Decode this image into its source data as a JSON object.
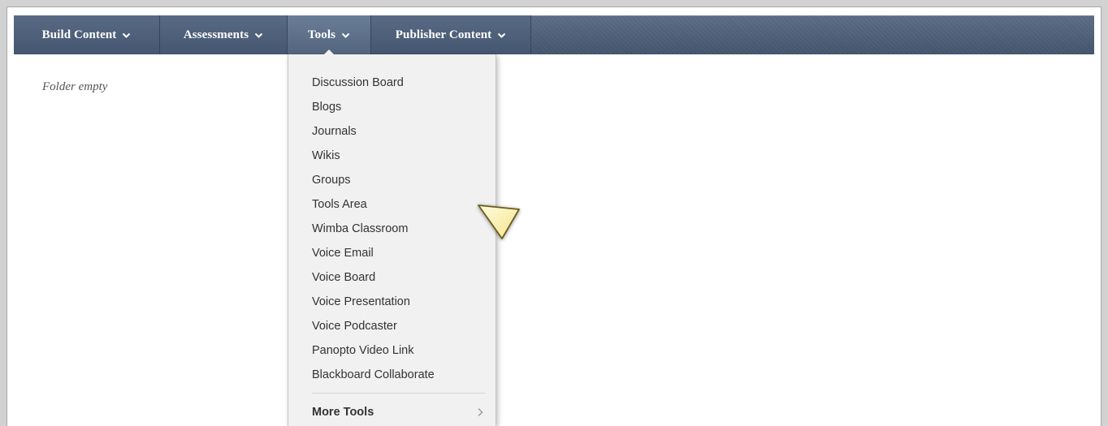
{
  "action_bar": {
    "menus": [
      {
        "label": "Build Content",
        "active": false
      },
      {
        "label": "Assessments",
        "active": false
      },
      {
        "label": "Tools",
        "active": true
      },
      {
        "label": "Publisher Content",
        "active": false
      }
    ]
  },
  "content": {
    "empty_text": "Folder empty"
  },
  "tools_menu": {
    "items": [
      "Discussion Board",
      "Blogs",
      "Journals",
      "Wikis",
      "Groups",
      "Tools Area",
      "Wimba Classroom",
      "Voice Email",
      "Voice Board",
      "Voice Presentation",
      "Voice Podcaster",
      "Panopto Video Link",
      "Blackboard Collaborate"
    ],
    "more_label": "More Tools"
  },
  "colors": {
    "action_bar": "#4e6078",
    "dropdown_bg": "#f1f1f1",
    "pointer_fill": "#fff7c0"
  },
  "icons": {
    "menu_chevron": "chevron-down-icon",
    "more_arrow": "chevron-right-icon",
    "pointer": "arrow-pointer-icon"
  }
}
